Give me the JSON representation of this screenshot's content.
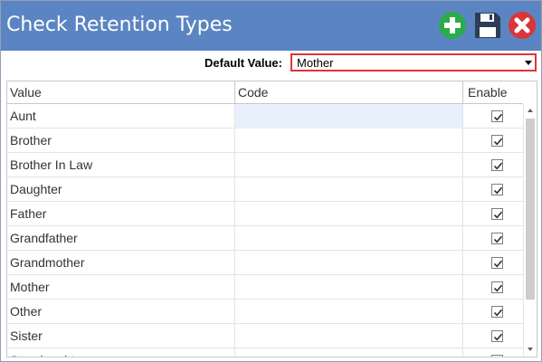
{
  "window": {
    "title": "Check Retention Types"
  },
  "toolbar": {
    "add_icon": "plus-circle-icon",
    "save_icon": "floppy-disk-icon",
    "close_icon": "close-circle-icon",
    "colors": {
      "add": "#2bab4a",
      "save": "#2c3e55",
      "close": "#d9363a"
    }
  },
  "default_value": {
    "label": "Default Value:",
    "selected": "Mother"
  },
  "grid": {
    "columns": {
      "value": "Value",
      "code": "Code",
      "enable": "Enable"
    },
    "rows": [
      {
        "value": "Aunt",
        "code": "",
        "enabled": true
      },
      {
        "value": "Brother",
        "code": "",
        "enabled": true
      },
      {
        "value": "Brother In Law",
        "code": "",
        "enabled": true
      },
      {
        "value": "Daughter",
        "code": "",
        "enabled": true
      },
      {
        "value": "Father",
        "code": "",
        "enabled": true
      },
      {
        "value": "Grandfather",
        "code": "",
        "enabled": true
      },
      {
        "value": "Grandmother",
        "code": "",
        "enabled": true
      },
      {
        "value": "Mother",
        "code": "",
        "enabled": true
      },
      {
        "value": "Other",
        "code": "",
        "enabled": true
      },
      {
        "value": "Sister",
        "code": "",
        "enabled": true
      },
      {
        "value": "Stepdaughter",
        "code": "",
        "enabled": true
      }
    ]
  },
  "colors": {
    "titlebar": "#5b85c2",
    "highlight_border": "#d9363a",
    "selected_cell": "#e8f1fb"
  }
}
